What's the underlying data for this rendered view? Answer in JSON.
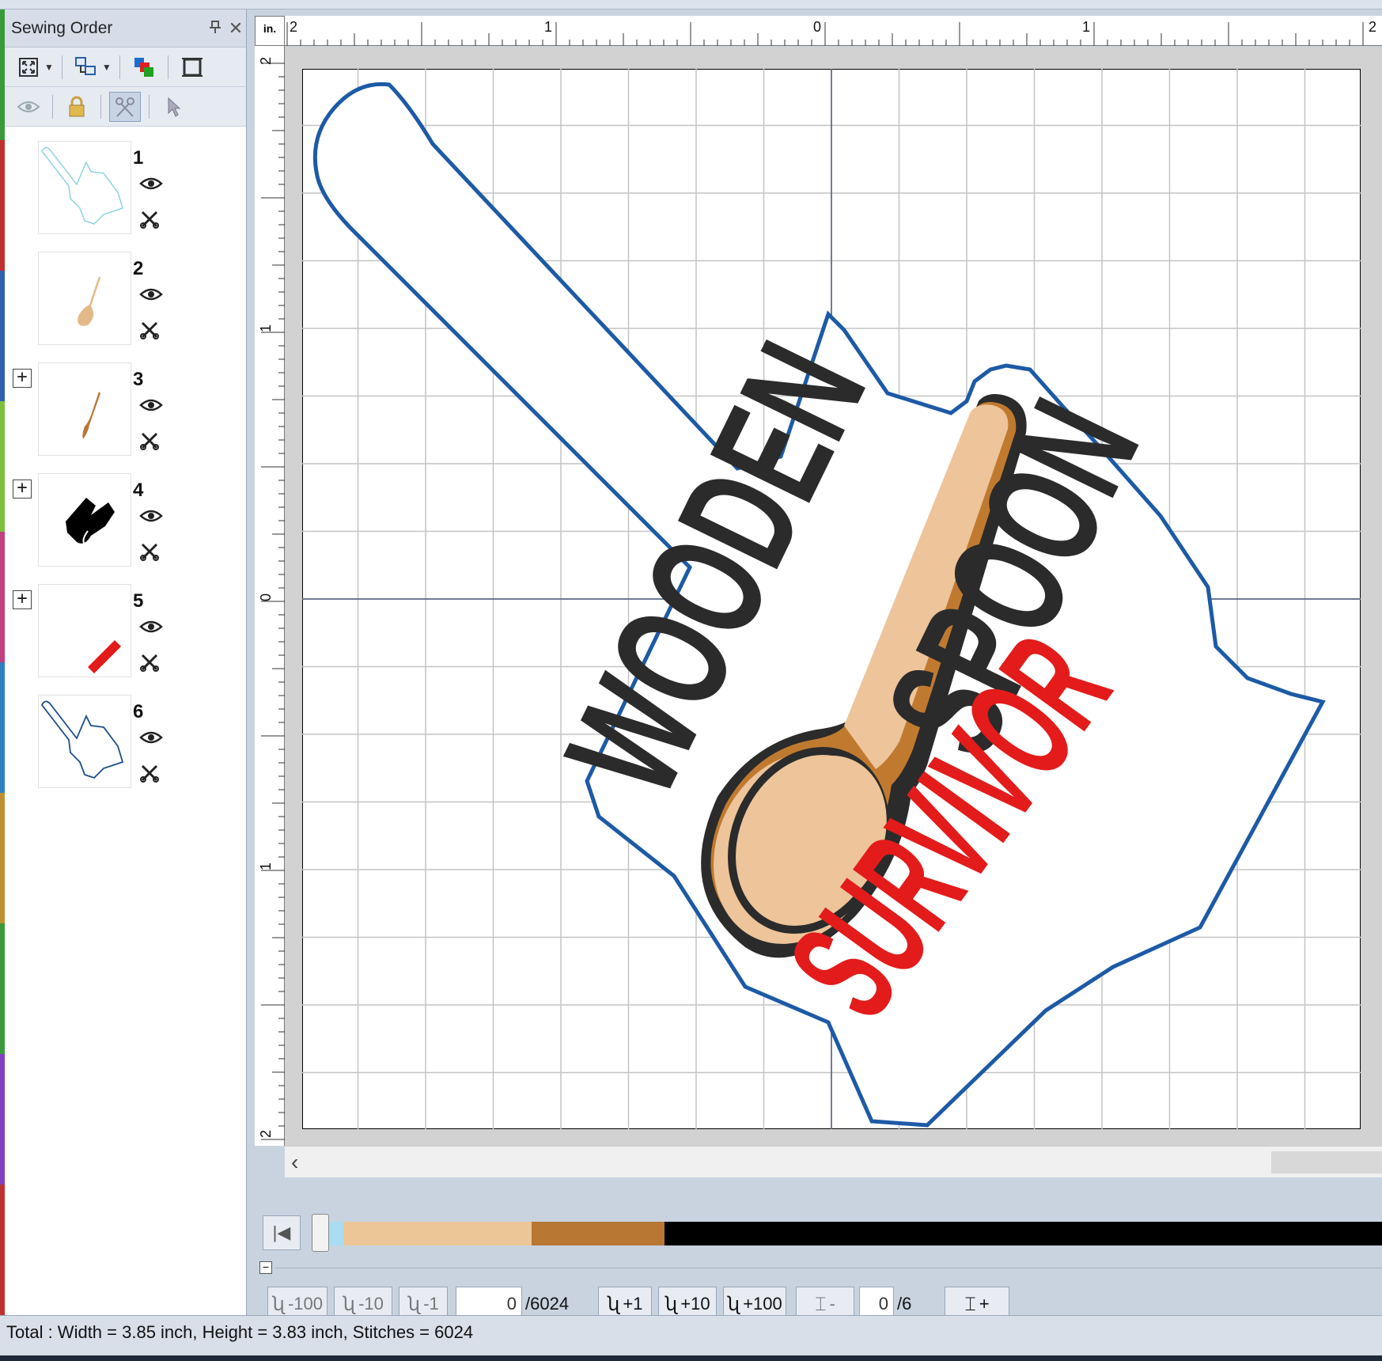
{
  "panel": {
    "title": "Sewing Order",
    "pin_icon": "pin-icon",
    "close_icon": "close-icon"
  },
  "sewing_items": [
    {
      "number": "1",
      "expandable": false,
      "color": "#8fd3e0"
    },
    {
      "number": "2",
      "expandable": false,
      "color": "#e3b98a"
    },
    {
      "number": "3",
      "expandable": true,
      "color": "#b87733"
    },
    {
      "number": "4",
      "expandable": true,
      "color": "#000000"
    },
    {
      "number": "5",
      "expandable": true,
      "color": "#e31b1b"
    },
    {
      "number": "6",
      "expandable": false,
      "color": "#1d4e8f"
    }
  ],
  "ruler": {
    "unit": "in.",
    "h_labels": [
      "2",
      "1",
      "0",
      "1",
      "2"
    ],
    "v_labels": [
      "2",
      "1",
      "0",
      "1",
      "2"
    ]
  },
  "design": {
    "word1": "WOODEN",
    "word2": "SPOON",
    "word3": "SURVIVOR",
    "colors": {
      "outline": "#1d5aa6",
      "text": "#2b2b2b",
      "survivor": "#e31b1b",
      "spoon_light": "#eec49a",
      "spoon_dark": "#c07a30"
    }
  },
  "color_bar": {
    "segments": [
      {
        "color": "#a9dcf0",
        "fraction": 0.024
      },
      {
        "color": "#edc697",
        "fraction": 0.177
      },
      {
        "color": "#b87733",
        "fraction": 0.125
      },
      {
        "color": "#000000",
        "fraction": 0.674
      }
    ]
  },
  "stitch_nav": {
    "minus100": "-100",
    "minus10": "-10",
    "minus1": "-1",
    "current_stitch": "0",
    "total_stitches": "/6024",
    "plus1": "+1",
    "plus10": "+10",
    "plus100": "+100",
    "color_minus": "-",
    "current_color": "0",
    "total_colors": "/6",
    "color_plus": "+"
  },
  "status": {
    "text": "Total : Width = 3.85 inch, Height = 3.83 inch, Stitches = 6024"
  }
}
